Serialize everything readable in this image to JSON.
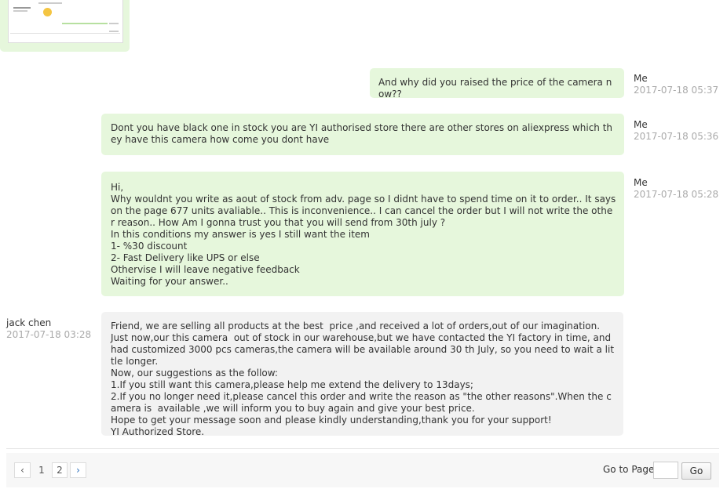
{
  "messages": [
    {
      "sender": "Me",
      "time": "2017-07-18 05:37",
      "text": "And why did you raised the price of the camera now??"
    },
    {
      "sender": "Me",
      "time": "2017-07-18 05:36",
      "text": "Dont you have black one in stock you are YI authorised store there are other stores on aliexpress which they have this camera how come you dont have"
    },
    {
      "sender": "Me",
      "time": "2017-07-18 05:28",
      "text": "Hi,\nWhy wouldnt you write as aout of stock from adv. page so I didnt have to spend time on it to order.. It says on the page 677 units avaliable.. This is inconvenience.. I can cancel the order but I will not write the other reason.. How Am I gonna trust you that you will send from 30th july ?\nIn this conditions my answer is yes I still want the item\n1- %30 discount\n2- Fast Delivery like UPS or else\nOthervise I will leave negative feedback\nWaiting for your answer.."
    },
    {
      "sender": "jack chen",
      "time": "2017-07-18 03:28",
      "text": "Friend, we are selling all products at the best  price ,and received a lot of orders,out of our imagination.\nJust now,our this camera  out of stock in our warehouse,but we have contacted the YI factory in time, and had customized 3000 pcs cameras,the camera will be available around 30 th July, so you need to wait a little longer.\nNow, our suggestions as the follow:\n1.If you still want this camera,please help me extend the delivery to 13days;\n2.If you no longer need it,please cancel this order and write the reason as \"the other reasons\".When the camera is  available ,we will inform you to buy again and give your best price.\nHope to get your message soon and please kindly understanding,thank you for your support!\nYI Authorized Store."
    }
  ],
  "pagination": {
    "prev": "‹",
    "pages": [
      "1",
      "2"
    ],
    "next": "›",
    "goto_label": "Go to Page",
    "goto_value": "",
    "go_button": "Go"
  },
  "colors": {
    "my_bubble": "#e6f7dc",
    "their_bubble": "#f2f2f2",
    "timestamp": "#aaaaaa"
  }
}
